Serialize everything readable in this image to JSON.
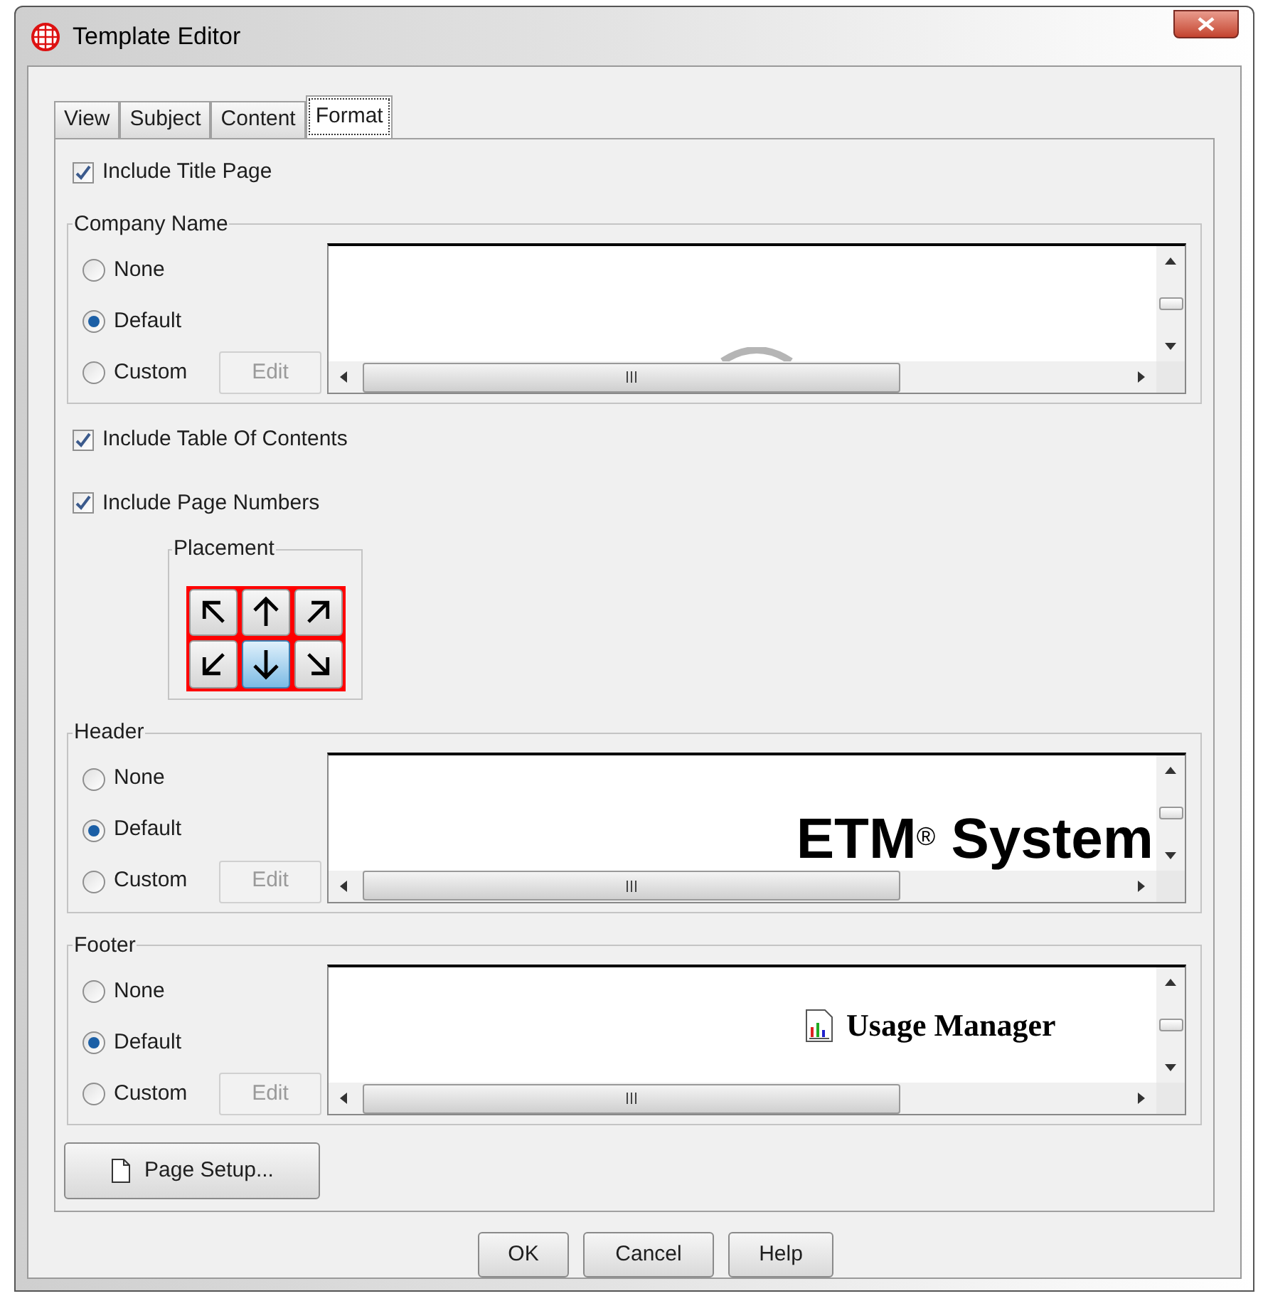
{
  "window": {
    "title": "Template Editor"
  },
  "tabs": [
    {
      "label": "View",
      "selected": false
    },
    {
      "label": "Subject",
      "selected": false
    },
    {
      "label": "Content",
      "selected": false
    },
    {
      "label": "Format",
      "selected": true
    }
  ],
  "include_title_page": {
    "label": "Include Title Page",
    "checked": true
  },
  "company_name": {
    "legend": "Company Name",
    "options": [
      {
        "label": "None",
        "selected": false
      },
      {
        "label": "Default",
        "selected": true
      },
      {
        "label": "Custom",
        "selected": false
      }
    ],
    "edit_button": {
      "label": "Edit",
      "disabled": true
    },
    "preview": {
      "kind": "logo"
    }
  },
  "include_table_of_contents": {
    "label": "Include Table Of Contents",
    "checked": true
  },
  "include_page_numbers": {
    "label": "Include Page Numbers",
    "checked": true
  },
  "placement": {
    "legend": "Placement",
    "positions": [
      {
        "kind": "up-left",
        "selected": false
      },
      {
        "kind": "up",
        "selected": false
      },
      {
        "kind": "up-right",
        "selected": false
      },
      {
        "kind": "down-left",
        "selected": false
      },
      {
        "kind": "down",
        "selected": true
      },
      {
        "kind": "down-right",
        "selected": false
      }
    ]
  },
  "header": {
    "legend": "Header",
    "options": [
      {
        "label": "None",
        "selected": false
      },
      {
        "label": "Default",
        "selected": true
      },
      {
        "label": "Custom",
        "selected": false
      }
    ],
    "edit_button": {
      "label": "Edit",
      "disabled": true
    },
    "preview": {
      "kind": "heading",
      "text": "ETM$^{®}$ System"
    }
  },
  "footer": {
    "legend": "Footer",
    "options": [
      {
        "label": "None",
        "selected": false
      },
      {
        "label": "Default",
        "selected": true
      },
      {
        "label": "Custom",
        "selected": false
      }
    ],
    "edit_button": {
      "label": "Edit",
      "disabled": true
    },
    "preview": {
      "kind": "titled-icon",
      "text": "Usage Manager"
    }
  },
  "page_setup_button": {
    "label": "Page Setup..."
  },
  "buttons": [
    "OK",
    "Cancel",
    "Help"
  ]
}
